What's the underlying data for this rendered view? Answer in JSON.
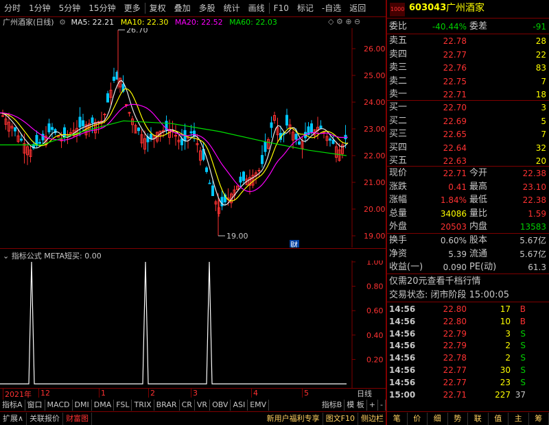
{
  "toolbar": {
    "items": [
      "分时",
      "1分钟",
      "5分钟",
      "15分钟",
      "更多",
      "复权",
      "叠加",
      "多股",
      "统计",
      "画线",
      "F10",
      "标记",
      "-自选",
      "返回"
    ]
  },
  "title": {
    "name": "广州酒家(日线)",
    "ma5": "MA5: 22.21",
    "ma10": "MA10: 22.30",
    "ma20": "MA20: 22.52",
    "ma60": "MA60: 22.03"
  },
  "price_axis": [
    "26.00",
    "25.00",
    "24.00",
    "23.00",
    "22.00",
    "21.00",
    "20.00",
    "19.00"
  ],
  "hi_label": "26.70",
  "lo_label": "19.00",
  "cai_label": "财",
  "indicator": {
    "title": "指标公式 META短买: 0.00",
    "axis": [
      "1.00",
      "0.80",
      "0.60",
      "0.40",
      "0.20"
    ]
  },
  "dates": [
    "2021年",
    "12",
    "1",
    "2",
    "3",
    "4",
    "5"
  ],
  "period": "日线",
  "tabs": [
    "指标A",
    "窗口",
    "MACD",
    "DMI",
    "DMA",
    "FSL",
    "TRIX",
    "BRAR",
    "CR",
    "VR",
    "OBV",
    "ASI",
    "EMV",
    "指标B",
    "模 板",
    "+",
    "-"
  ],
  "status": [
    "扩展∧",
    "关联报价",
    "财富图",
    "新用户福利专享",
    "图文F10",
    "侧边栏"
  ],
  "quote": {
    "code": "603043",
    "name": "广州酒家",
    "badge": "1000",
    "weibi_label": "委比",
    "weibi": "-40.44%",
    "weicha_label": "委差",
    "weicha": "-91",
    "asks": [
      {
        "l": "卖五",
        "p": "22.78",
        "v": "28"
      },
      {
        "l": "卖四",
        "p": "22.77",
        "v": "22"
      },
      {
        "l": "卖三",
        "p": "22.76",
        "v": "83"
      },
      {
        "l": "卖二",
        "p": "22.75",
        "v": "7"
      },
      {
        "l": "卖一",
        "p": "22.71",
        "v": "18"
      }
    ],
    "bids": [
      {
        "l": "买一",
        "p": "22.70",
        "v": "3"
      },
      {
        "l": "买二",
        "p": "22.69",
        "v": "5"
      },
      {
        "l": "买三",
        "p": "22.65",
        "v": "7"
      },
      {
        "l": "买四",
        "p": "22.64",
        "v": "32"
      },
      {
        "l": "买五",
        "p": "22.63",
        "v": "20"
      }
    ],
    "stats": [
      {
        "l1": "现价",
        "v1": "22.71",
        "l2": "今开",
        "v2": "22.38"
      },
      {
        "l1": "涨跌",
        "v1": "0.41",
        "l2": "最高",
        "v2": "23.10"
      },
      {
        "l1": "涨幅",
        "v1": "1.84%",
        "l2": "最低",
        "v2": "22.38"
      },
      {
        "l1": "总量",
        "v1": "34086",
        "l2": "量比",
        "v2": "1.59"
      },
      {
        "l1": "外盘",
        "v1": "20503",
        "l2": "内盘",
        "v2": "13583"
      }
    ],
    "stats2": [
      {
        "l1": "换手",
        "v1": "0.60%",
        "l2": "股本",
        "v2": "5.67亿"
      },
      {
        "l1": "净资",
        "v1": "5.39",
        "l2": "流通",
        "v2": "5.67亿"
      },
      {
        "l1": "收益(一)",
        "v1": "0.090",
        "l2": "PE(动)",
        "v2": "61.3"
      }
    ],
    "promo": "仅需20元查看千档行情",
    "state": "交易状态: 闭市阶段 15:00:05",
    "ticks": [
      {
        "t": "14:56",
        "p": "22.80",
        "v": "17",
        "f": "B"
      },
      {
        "t": "14:56",
        "p": "22.80",
        "v": "10",
        "f": "B"
      },
      {
        "t": "14:56",
        "p": "22.79",
        "v": "3",
        "f": "S"
      },
      {
        "t": "14:56",
        "p": "22.79",
        "v": "2",
        "f": "S"
      },
      {
        "t": "14:56",
        "p": "22.78",
        "v": "2",
        "f": "S"
      },
      {
        "t": "14:56",
        "p": "22.77",
        "v": "30",
        "f": "S"
      },
      {
        "t": "14:56",
        "p": "22.77",
        "v": "23",
        "f": "S"
      },
      {
        "t": "15:00",
        "p": "22.71",
        "v": "227",
        "f": "37"
      }
    ]
  },
  "sidebar": [
    "笔",
    "价",
    "细",
    "势",
    "联",
    "值",
    "主",
    "筹"
  ]
}
